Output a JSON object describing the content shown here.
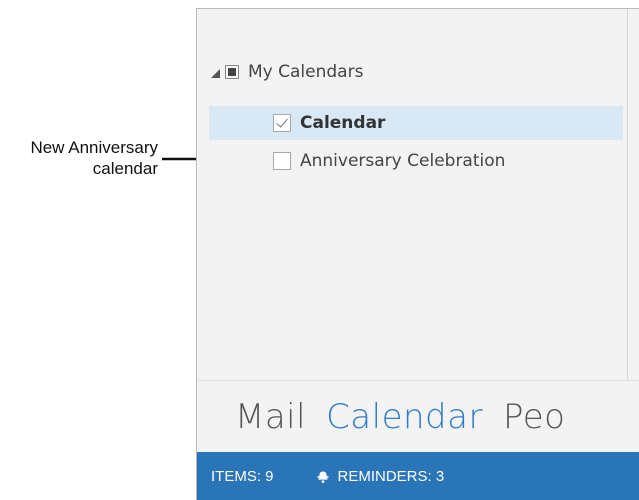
{
  "annotation": {
    "line1": "New Anniversary",
    "line2": "calendar"
  },
  "folder_pane": {
    "group": {
      "label": "My Calendars"
    },
    "calendars": [
      {
        "label": "Calendar",
        "checked": true,
        "selected": true
      },
      {
        "label": "Anniversary Celebration",
        "checked": false,
        "selected": false
      }
    ]
  },
  "nav_bar": {
    "items": [
      "Mail",
      "Calendar",
      "Peo"
    ],
    "active": "Calendar",
    "active_color": "#2d7dc7"
  },
  "status_bar": {
    "items": "ITEMS: 9",
    "reminders": "REMINDERS: 3",
    "background": "#2a74b8",
    "reminder_icon": "bell-icon"
  },
  "colors": {
    "pane_background": "#f3f3f3",
    "selected_row": "#d8e8f5"
  }
}
